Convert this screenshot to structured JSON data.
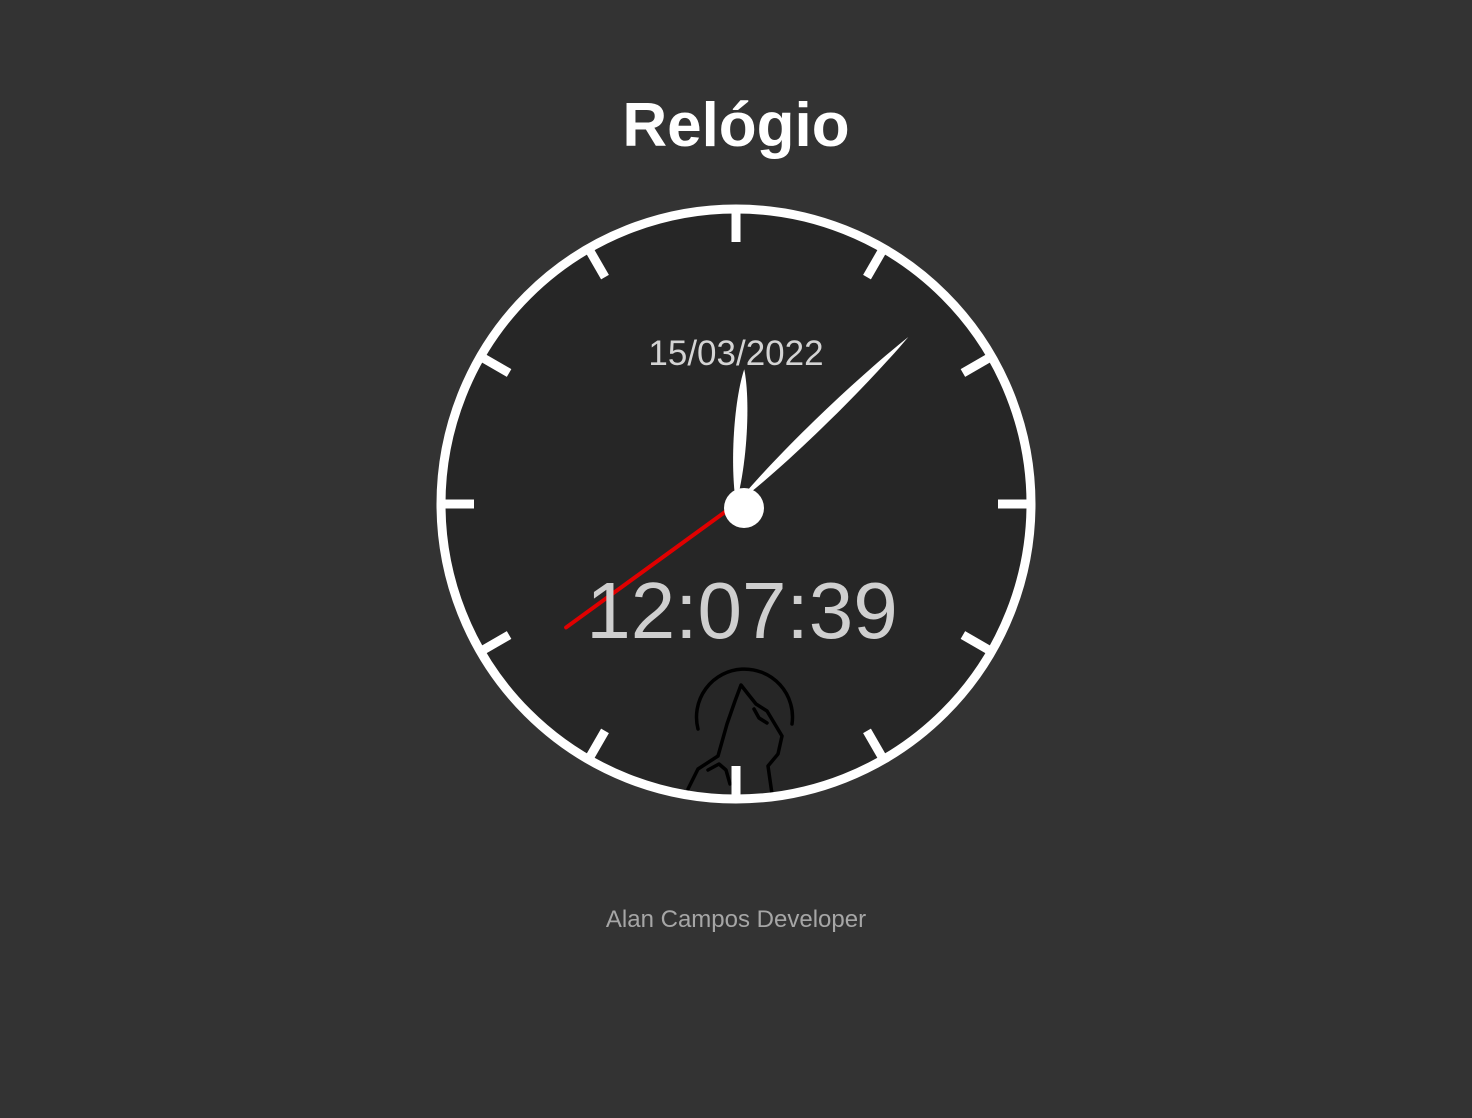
{
  "header": {
    "title": "Relógio"
  },
  "clock": {
    "date": "15/03/2022",
    "time": "12:07:39",
    "hours": 12,
    "minutes": 7,
    "seconds": 39,
    "logo_icon": "howling-wolf-icon",
    "colors": {
      "face": "#262626",
      "rim": "#ffffff",
      "hands": "#ffffff",
      "second_hand": "#e00000",
      "logo": "#000000"
    }
  },
  "footer": {
    "credit": "Alan Campos Developer"
  }
}
